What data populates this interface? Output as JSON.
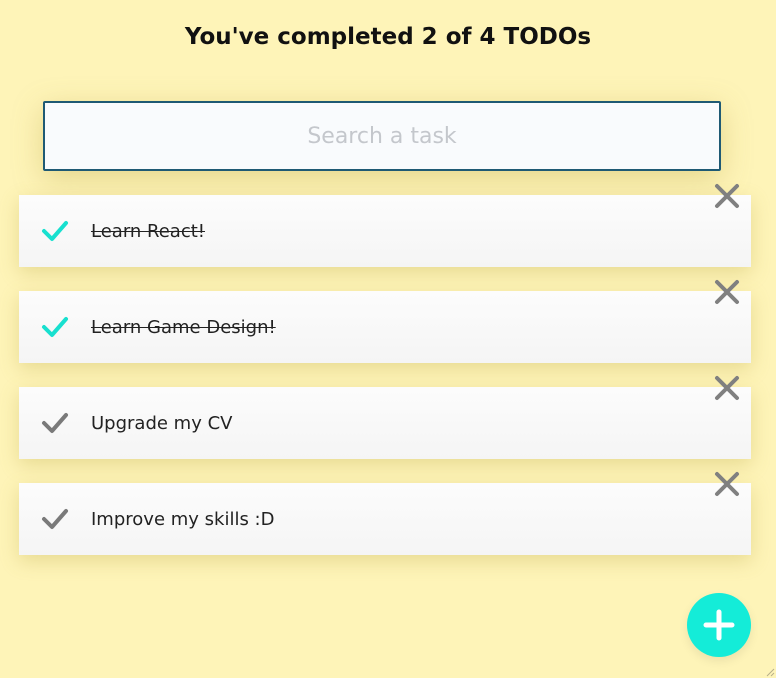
{
  "header": {
    "title": "You've completed 2 of 4 TODOs"
  },
  "search": {
    "placeholder": "Search a task",
    "value": ""
  },
  "todos": [
    {
      "text": "Learn React!",
      "completed": true
    },
    {
      "text": "Learn Game Design!",
      "completed": true
    },
    {
      "text": "Upgrade my CV",
      "completed": false
    },
    {
      "text": "Improve my skills :D",
      "completed": false
    }
  ],
  "colors": {
    "background": "#fef4b8",
    "accent": "#14ecd8",
    "check_done": "#18e0cf",
    "check_pending": "#7a7a7a",
    "delete": "#808080",
    "search_border": "#1f5a74"
  },
  "icons": {
    "check": "check-icon",
    "delete": "close-icon",
    "add": "plus-icon",
    "resize": "resize-grip-icon"
  }
}
